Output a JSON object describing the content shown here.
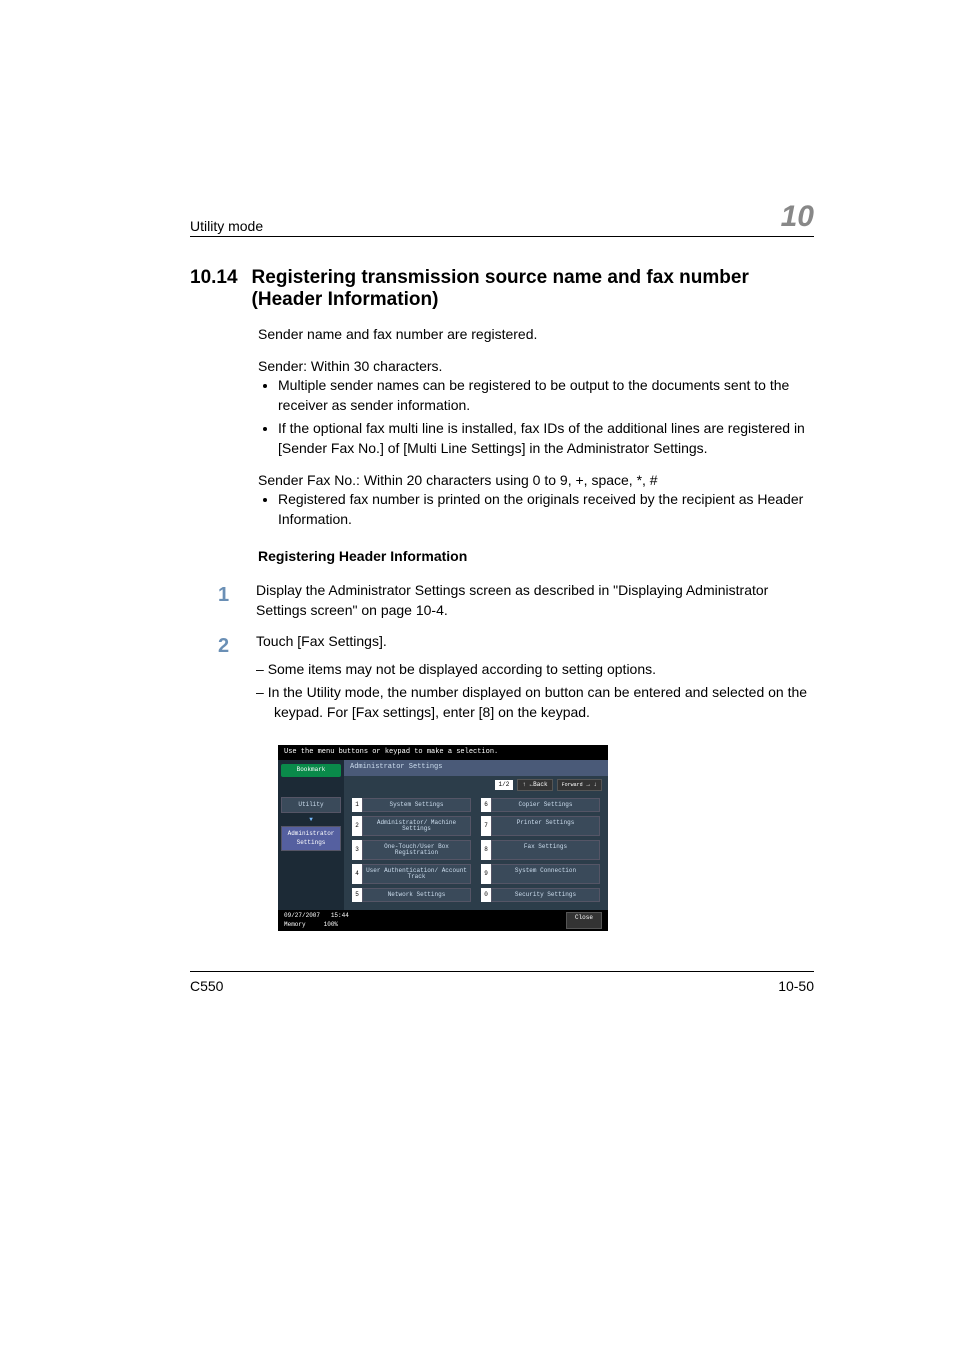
{
  "header": {
    "left": "Utility mode",
    "right": "10"
  },
  "section": {
    "number": "10.14",
    "title": "Registering transmission source name and fax number (Header Information)"
  },
  "intro": "Sender name and fax number are registered.",
  "sender_line": "Sender: Within 30 characters.",
  "sender_bullets": [
    "Multiple sender names can be registered to be output to the documents sent to the receiver as sender information.",
    "If the optional fax multi line is installed, fax IDs of the additional lines are registered in [Sender Fax No.] of [Multi Line Settings] in the Administrator Settings."
  ],
  "faxno_line": "Sender Fax No.: Within 20 characters using 0 to 9, +, space, *, #",
  "faxno_bullets": [
    "Registered fax number is printed on the originals received by the recipient as Header Information."
  ],
  "subhead": "Registering Header Information",
  "steps": [
    {
      "num": "1",
      "text": "Display the Administrator Settings screen as described in \"Displaying Administrator Settings screen\" on page 10-4."
    },
    {
      "num": "2",
      "text": "Touch [Fax Settings].",
      "dashes": [
        "Some items may not be displayed according to setting options.",
        "In the Utility mode, the number displayed on button can be entered and selected on the keypad. For [Fax settings], enter [8] on the keypad."
      ]
    }
  ],
  "screenshot": {
    "top_instruction": "Use the menu buttons or keypad to make a selection.",
    "bookmark": "Bookmark",
    "left_tabs": [
      "Utility",
      "Administrator Settings"
    ],
    "title": "Administrator Settings",
    "page_counter": "1/2",
    "back_label": "Back",
    "forward_label": "Forward",
    "menu": [
      {
        "n": "1",
        "label": "System Settings"
      },
      {
        "n": "6",
        "label": "Copier Settings"
      },
      {
        "n": "2",
        "label": "Administrator/ Machine Settings"
      },
      {
        "n": "7",
        "label": "Printer Settings"
      },
      {
        "n": "3",
        "label": "One-Touch/User Box Registration"
      },
      {
        "n": "8",
        "label": "Fax Settings"
      },
      {
        "n": "4",
        "label": "User Authentication/ Account Track"
      },
      {
        "n": "9",
        "label": "System Connection"
      },
      {
        "n": "5",
        "label": "Network Settings"
      },
      {
        "n": "0",
        "label": "Security Settings"
      }
    ],
    "footer_date": "09/27/2007",
    "footer_time": "15:44",
    "footer_mem_label": "Memory",
    "footer_mem_value": "100%",
    "close": "Close"
  },
  "footer": {
    "left": "C550",
    "right": "10-50"
  }
}
